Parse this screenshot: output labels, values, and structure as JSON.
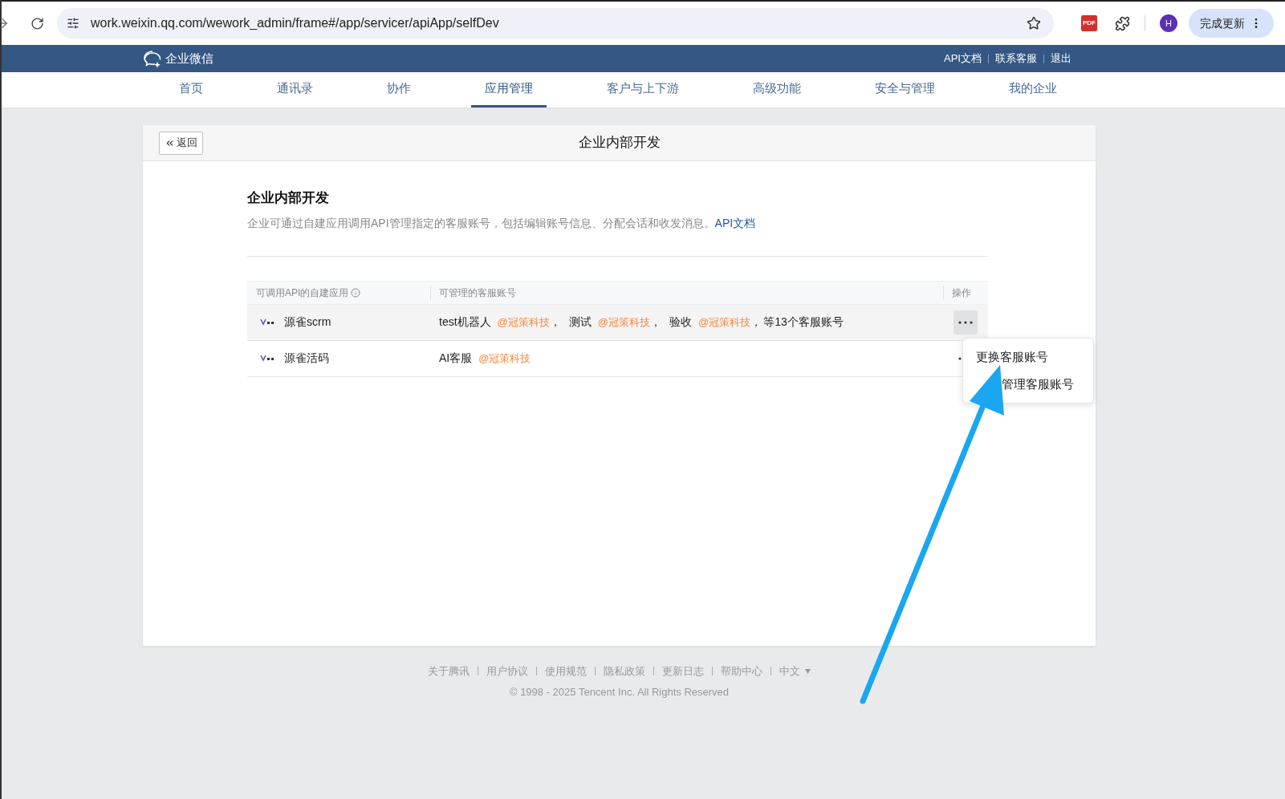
{
  "browser": {
    "url": "work.weixin.qq.com/wework_admin/frame#/app/servicer/apiApp/selfDev",
    "update_button": "完成更新",
    "avatar": "H",
    "pdf_label": "PDF"
  },
  "header": {
    "brand": "企业微信",
    "links": [
      "API文档",
      "联系客服",
      "退出"
    ]
  },
  "nav": [
    {
      "label": "首页",
      "selected": false
    },
    {
      "label": "通讯录",
      "selected": false
    },
    {
      "label": "协作",
      "selected": false
    },
    {
      "label": "应用管理",
      "selected": true
    },
    {
      "label": "客户与上下游",
      "selected": false
    },
    {
      "label": "高级功能",
      "selected": false
    },
    {
      "label": "安全与管理",
      "selected": false
    },
    {
      "label": "我的企业",
      "selected": false
    }
  ],
  "card": {
    "back": "返回",
    "title": "企业内部开发",
    "heading": "企业内部开发",
    "description": "企业可通过自建应用调用API管理指定的客服账号，包括编辑账号信息、分配会话和收发消息。",
    "description_link": "API文档"
  },
  "table": {
    "columns": [
      "可调用API的自建应用",
      "可管理的客服账号",
      "操作"
    ],
    "rows": [
      {
        "app": "源雀scrm",
        "selected": true,
        "accounts": [
          {
            "name": "test机器人",
            "corp": "@冠策科技",
            "sep": "，"
          },
          {
            "name": "测试",
            "corp": "@冠策科技",
            "sep": "，"
          },
          {
            "name": "验收",
            "corp": "@冠策科技",
            "sep": "，"
          }
        ],
        "more": "等13个客服账号"
      },
      {
        "app": "源雀活码",
        "selected": false,
        "accounts": [
          {
            "name": "AI客服",
            "corp": "@冠策科技"
          }
        ]
      }
    ]
  },
  "menu": {
    "items": [
      {
        "label": "更换客服账号",
        "kind": "plain"
      },
      {
        "label": "管理客服账号",
        "kind": "partly_hidden"
      }
    ]
  },
  "footer": {
    "links": [
      "关于腾讯",
      "用户协议",
      "使用规范",
      "隐私政策",
      "更新日志",
      "帮助中心"
    ],
    "language": "中文",
    "copyright": "© 1998 - 2025 Tencent Inc. All Rights Reserved"
  }
}
